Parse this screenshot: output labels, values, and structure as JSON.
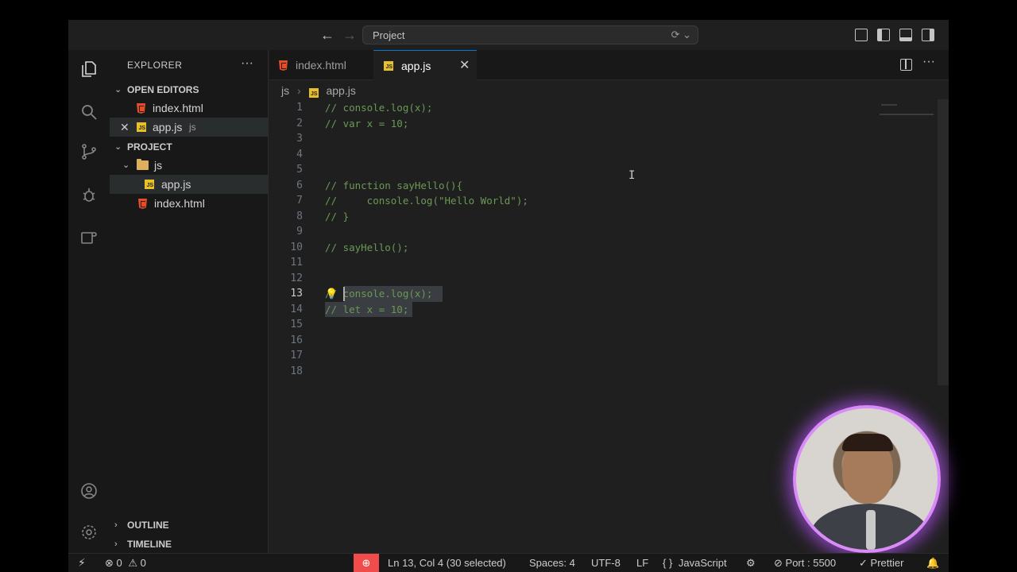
{
  "titlebar": {
    "search": "Project"
  },
  "sidebar": {
    "title": "EXPLORER",
    "open_editors_title": "OPEN EDITORS",
    "open_editors": [
      {
        "name": "index.html",
        "kind": "html"
      },
      {
        "name": "app.js",
        "kind": "js",
        "hint": "js"
      }
    ],
    "project_title": "PROJECT",
    "tree": [
      {
        "name": "js",
        "kind": "folder"
      },
      {
        "name": "app.js",
        "kind": "js"
      },
      {
        "name": "index.html",
        "kind": "html"
      }
    ],
    "outline": "OUTLINE",
    "timeline": "TIMELINE"
  },
  "tabs": [
    {
      "label": "index.html",
      "kind": "html",
      "active": false
    },
    {
      "label": "app.js",
      "kind": "js",
      "active": true
    }
  ],
  "breadcrumb": {
    "folder": "js",
    "file": "app.js"
  },
  "editor": {
    "lines": [
      {
        "n": "1",
        "text": "// console.log(x);"
      },
      {
        "n": "2",
        "text": "// var x = 10;"
      },
      {
        "n": "3",
        "text": ""
      },
      {
        "n": "4",
        "text": ""
      },
      {
        "n": "5",
        "text": ""
      },
      {
        "n": "6",
        "text": "// function sayHello(){"
      },
      {
        "n": "7",
        "text": "//     console.log(\"Hello World\");"
      },
      {
        "n": "8",
        "text": "// }"
      },
      {
        "n": "9",
        "text": ""
      },
      {
        "n": "10",
        "text": "// sayHello();"
      },
      {
        "n": "11",
        "text": ""
      },
      {
        "n": "12",
        "text": ""
      },
      {
        "n": "13",
        "text": "// console.log(x);"
      },
      {
        "n": "14",
        "text": "// let x = 10;"
      },
      {
        "n": "15",
        "text": ""
      },
      {
        "n": "16",
        "text": ""
      },
      {
        "n": "17",
        "text": ""
      },
      {
        "n": "18",
        "text": ""
      }
    ]
  },
  "status": {
    "errors": "0",
    "warnings": "0",
    "position": "Ln 13, Col 4 (30 selected)",
    "spaces": "Spaces: 4",
    "encoding": "UTF-8",
    "eol": "LF",
    "language": "JavaScript",
    "port": "Port : 5500",
    "prettier": "Prettier"
  },
  "colors": {
    "accent": "#0078d4",
    "comment": "#6a9955",
    "html_icon": "#e44d26",
    "js_icon": "#e8c02a",
    "zoom_badge": "#f14c4c"
  }
}
